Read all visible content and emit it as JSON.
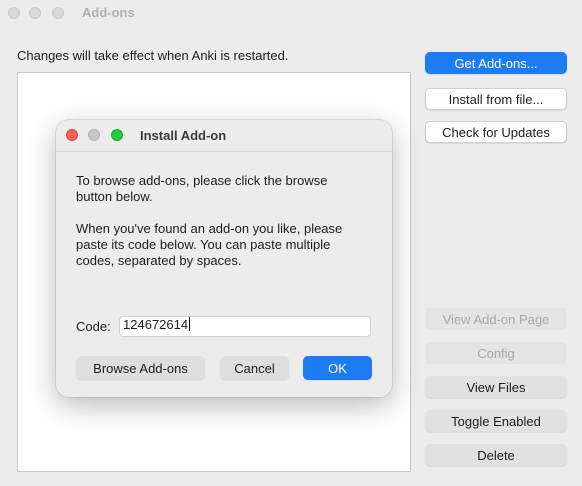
{
  "window": {
    "title": "Add-ons",
    "notice": "Changes will take effect when Anki is restarted."
  },
  "sidebar": {
    "get_addons": "Get Add-ons...",
    "install_from_file": "Install from file...",
    "check_updates": "Check for Updates",
    "view_page": "View Add-on Page",
    "config": "Config",
    "view_files": "View Files",
    "toggle_enabled": "Toggle Enabled",
    "delete": "Delete"
  },
  "dialog": {
    "title": "Install Add-on",
    "para1": "To browse add-ons, please click the browse\nbutton below.",
    "para2": "When you've found an add-on you like, please\npaste its code below. You can paste multiple\ncodes, separated by spaces.",
    "code_label": "Code:",
    "code_value": "124672614",
    "browse": "Browse Add-ons",
    "cancel": "Cancel",
    "ok": "OK"
  },
  "colors": {
    "accent": "#1d7cf2",
    "close": "#ff5f57",
    "minimize": "#c8c8c8",
    "maximize": "#28c840"
  }
}
